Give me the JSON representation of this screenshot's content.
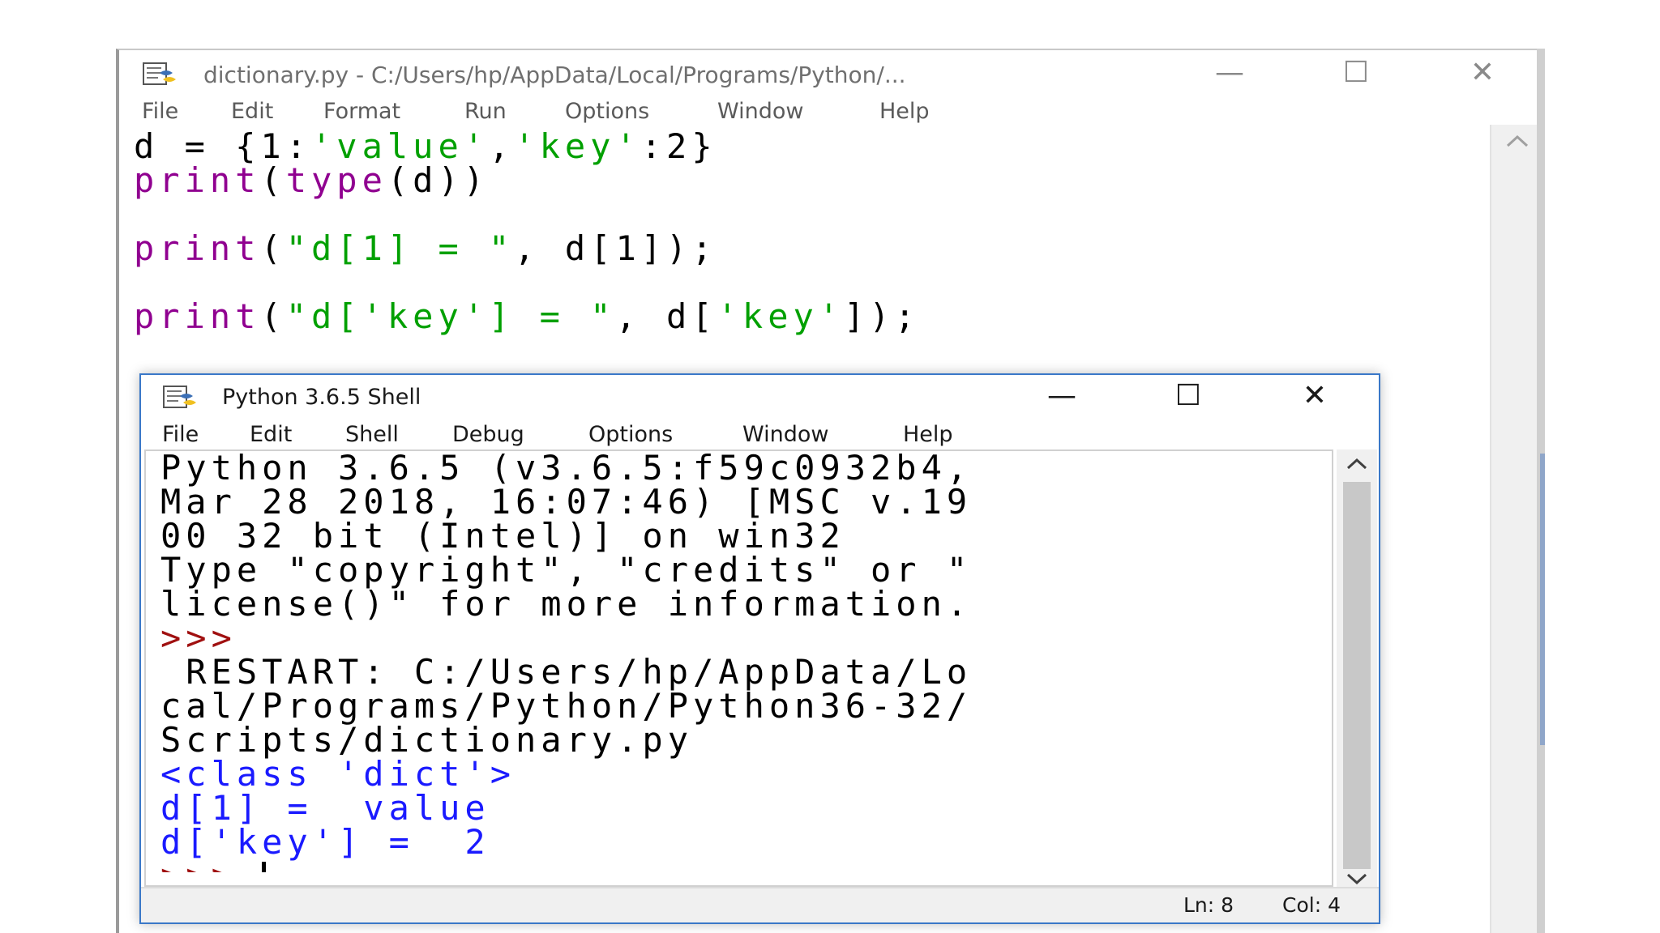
{
  "editor": {
    "title": "dictionary.py - C:/Users/hp/AppData/Local/Programs/Python/...",
    "menu": [
      "File",
      "Edit",
      "Format",
      "Run",
      "Options",
      "Window",
      "Help"
    ],
    "code": {
      "line1": {
        "a": "d = {1:",
        "b": "'value'",
        "c": ",",
        "d": "'key'",
        "e": ":2}"
      },
      "line2": {
        "a": "print",
        "b": "(",
        "c": "type",
        "d": "(d))"
      },
      "line3": {
        "a": "print",
        "b": "(",
        "c": "\"d[1] = \"",
        "d": ", d[1]);"
      },
      "line4": {
        "a": "print",
        "b": "(",
        "c": "\"d['key'] = \"",
        "d": ", d[",
        "e": "'key'",
        "f": "]);"
      }
    }
  },
  "shell": {
    "title": "Python 3.6.5 Shell",
    "menu": [
      "File",
      "Edit",
      "Shell",
      "Debug",
      "Options",
      "Window",
      "Help"
    ],
    "lines": {
      "l1": "Python 3.6.5 (v3.6.5:f59c0932b4,",
      "l2": "Mar 28 2018, 16:07:46) [MSC v.19",
      "l3": "00 32 bit (Intel)] on win32",
      "l4": "Type \"copyright\", \"credits\" or \"",
      "l5": "license()\" for more information.",
      "p1": ">>>",
      "l6": " RESTART: C:/Users/hp/AppData/Lo",
      "l7": "cal/Programs/Python/Python36-32/",
      "l8": "Scripts/dictionary.py",
      "o1": "<class 'dict'>",
      "o2": "d[1] =  value",
      "o3": "d['key'] =  2",
      "p2": ">>> "
    },
    "status": {
      "ln": "Ln: 8",
      "col": "Col: 4"
    }
  },
  "window_controls": {
    "minimize": "—",
    "maximize": "☐",
    "close": "✕"
  },
  "colors": {
    "keyword": "#900090",
    "string": "#00a000",
    "output": "#1a1aff",
    "prompt": "#a01010",
    "shell_border": "#3a78c8"
  }
}
